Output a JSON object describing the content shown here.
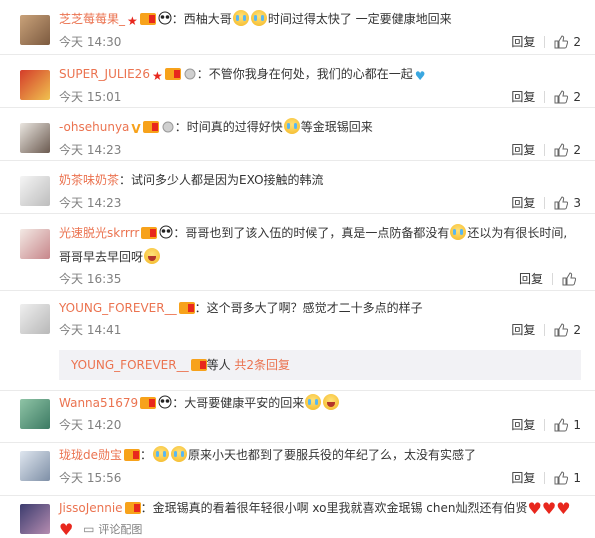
{
  "actions": {
    "reply": "回复"
  },
  "comments": [
    {
      "username": "芝芝莓莓果_",
      "text_a": "西柚大哥",
      "text_b": "时间过得太快了 一定要健康地回来",
      "time": "今天 14:30",
      "likes": "2"
    },
    {
      "username": "SUPER_JULIE26",
      "text_a": "不管你我身在何处，我们的心都在一起",
      "time": "今天 15:01",
      "likes": "2"
    },
    {
      "username": "-ohsehunya",
      "text_a": "时间真的过得好快",
      "text_b": "等金珉锡回来",
      "time": "今天 14:23",
      "likes": "2"
    },
    {
      "username": "奶茶味奶茶",
      "text_a": "试问多少人都是因为EXO接触的韩流",
      "time": "今天 14:23",
      "likes": "3"
    },
    {
      "username": "光速脱光skrrrr",
      "text_a": "哥哥也到了该入伍的时候了，真是一点防备都没有",
      "text_b": "还以为有很长时间,",
      "text_c": "哥哥早去早回呀",
      "time": "今天 16:35",
      "likes": ""
    },
    {
      "username": "YOUNG_FOREVER__",
      "text_a": "这个哥多大了啊？感觉才二十多点的样子",
      "time": "今天 14:41",
      "likes": "2"
    },
    {
      "username": "Wanna51679",
      "text_a": "大哥要健康平安的回来",
      "time": "今天 14:20",
      "likes": "1"
    },
    {
      "username": "珑珑de勋宝",
      "text_a": "原来小天也都到了要服兵役的年纪了么，太没有实感了",
      "time": "今天 15:56",
      "likes": "1"
    },
    {
      "username": "JissoJennie",
      "text_a": "金珉锡真的看着很年轻很小啊 xo里我就喜欢金珉锡 chen灿烈还有伯贤",
      "view_image": "评论配图"
    }
  ],
  "reply_summary": {
    "username": "YOUNG_FOREVER__",
    "middle": "等人",
    "count_text": "共2条回复"
  },
  "colors": {
    "link": "#eb7350",
    "muted": "#808080",
    "text": "#333333",
    "reply_bg": "#f2f2f5",
    "heart": "#e8271d"
  }
}
